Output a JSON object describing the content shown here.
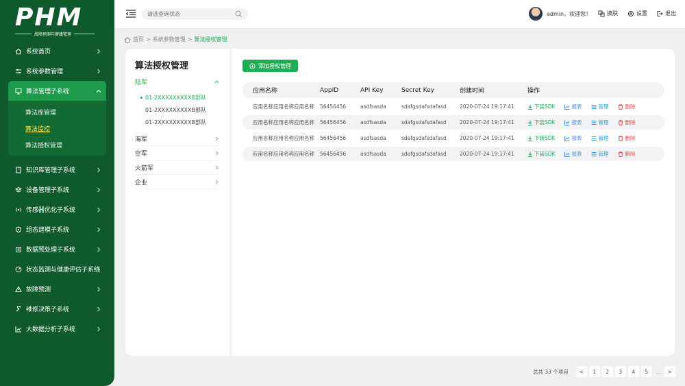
{
  "logo": {
    "text": "PHM",
    "subtitle": "故障预测与健康管理"
  },
  "sidebar": {
    "items": [
      {
        "label": "系统首页",
        "icon": "home-icon"
      },
      {
        "label": "系统参数管理",
        "icon": "sliders-icon"
      },
      {
        "label": "算法管理子系统",
        "icon": "monitor-icon",
        "expanded": true,
        "children": [
          {
            "label": "算法库管理"
          },
          {
            "label": "算法监控"
          },
          {
            "label": "算法授权管理"
          }
        ]
      },
      {
        "label": "知识库管理子系统",
        "icon": "book-icon"
      },
      {
        "label": "设备管理子系统",
        "icon": "layers-icon"
      },
      {
        "label": "传感器优化子系统",
        "icon": "radio-icon"
      },
      {
        "label": "组态建模子系统",
        "icon": "gear-shield-icon"
      },
      {
        "label": "数据预处理子系统",
        "icon": "database-icon"
      },
      {
        "label": "状态监测与健康评估子系统",
        "icon": "gauge-icon"
      },
      {
        "label": "故障预测",
        "icon": "alert-icon"
      },
      {
        "label": "维修决策子系统",
        "icon": "wrench-icon"
      },
      {
        "label": "大数据分析子系统",
        "icon": "chart-line-icon"
      }
    ]
  },
  "topbar": {
    "search_placeholder": "请选查询状态",
    "user": "admin，欢迎您！",
    "skin": "换肤",
    "settings": "设置",
    "logout": "退出"
  },
  "breadcrumb": {
    "home": "首页",
    "sep": ">",
    "level1": "系统参数管理",
    "current": "算法授权管理"
  },
  "panel": {
    "title": "算法授权管理",
    "tree": [
      {
        "label": "陆军",
        "expanded": true,
        "children": [
          "01-2XXXXXXXXXB部队",
          "01-2XXXXXXXXXB部队",
          "01-2XXXXXXXXXB部队"
        ]
      },
      {
        "label": "海军"
      },
      {
        "label": "空军"
      },
      {
        "label": "火箭军"
      },
      {
        "label": "企业"
      }
    ]
  },
  "add_button": "添加授权管理",
  "table": {
    "headers": [
      "应用名称",
      "AppID",
      "API Key",
      "Secret Key",
      "创建时间",
      "操作"
    ],
    "rows": [
      {
        "name": "应用名称应用名称应用名称",
        "appid": "56456456",
        "apikey": "asdfsasda",
        "secret": "sdafgsdafsdafasd",
        "time": "2020-07-24 19:17:41"
      },
      {
        "name": "应用名称应用名称应用名称",
        "appid": "56456456",
        "apikey": "asdfsasda",
        "secret": "sdafgsdafsdafasd",
        "time": "2020-07-24 19:17:41"
      },
      {
        "name": "应用名称应用名称应用名称",
        "appid": "56456456",
        "apikey": "asdfsasda",
        "secret": "sdafgsdafsdafasd",
        "time": "2020-07-24 19:17:41"
      },
      {
        "name": "应用名称应用名称应用名称",
        "appid": "56456456",
        "apikey": "asdfsasda",
        "secret": "sdafgsdafsdafasd",
        "time": "2020-07-24 19:17:41"
      }
    ],
    "actions": {
      "download": "下装SDK",
      "report": "报表",
      "manage": "管理",
      "delete": "删除"
    }
  },
  "pagination": {
    "total": "总共 33 个项目",
    "pages": [
      "1",
      "2",
      "3",
      "4",
      "5"
    ],
    "ellipsis": "...",
    "prev": "<",
    "next": ">"
  },
  "colors": {
    "sidebar": "#0f5a2c",
    "accent": "#1eae57",
    "report": "#4a90e2",
    "delete": "#e24c4c"
  }
}
